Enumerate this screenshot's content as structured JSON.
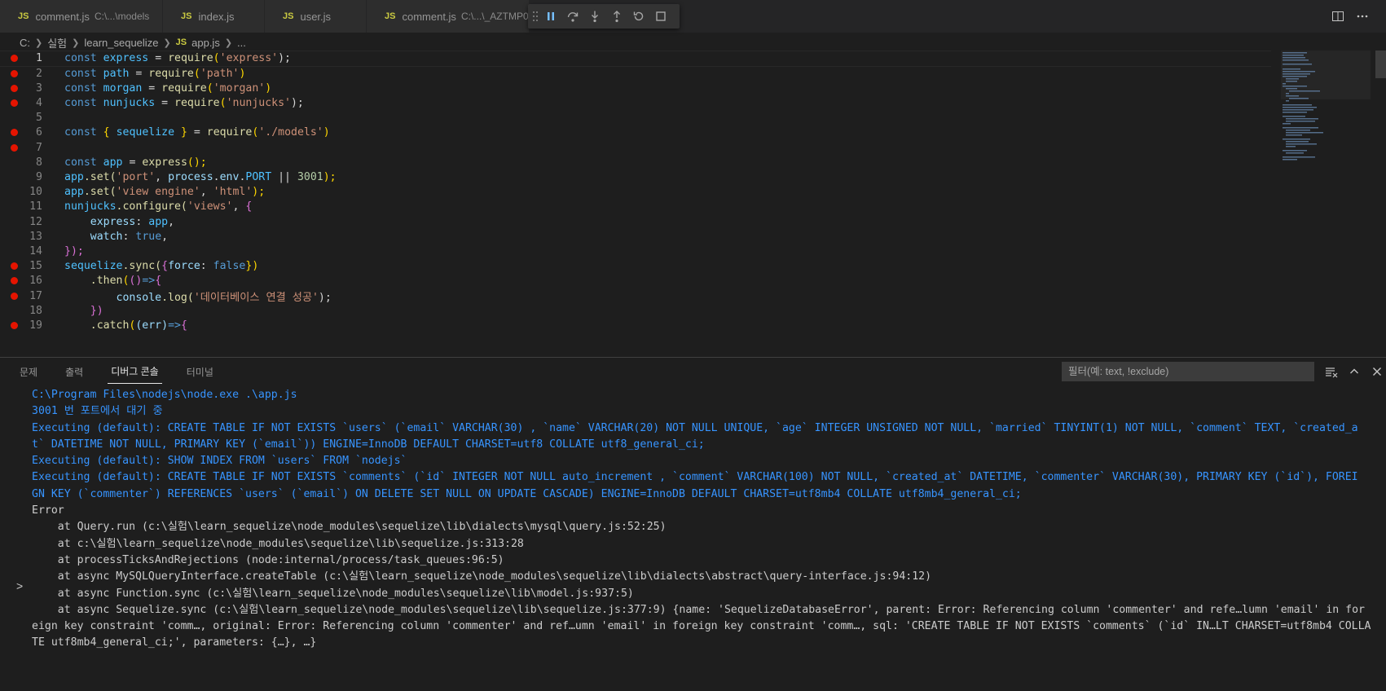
{
  "tabs": [
    {
      "icon": "JS",
      "name": "comment.js",
      "desc": "C:\\...\\models",
      "active": false
    },
    {
      "icon": "JS",
      "name": "index.js",
      "desc": "",
      "active": false
    },
    {
      "icon": "JS",
      "name": "user.js",
      "desc": "",
      "active": false
    },
    {
      "icon": "JS",
      "name": "comment.js",
      "desc": "C:\\...\\_AZTMP0",
      "active": false
    }
  ],
  "breadcrumb": {
    "drive": "C:",
    "folder1": "실험",
    "folder2": "learn_sequelize",
    "file_icon": "JS",
    "file": "app.js",
    "more": "..."
  },
  "editor": {
    "current_line": 1,
    "lines": [
      {
        "n": "1",
        "bp": true
      },
      {
        "n": "2",
        "bp": true
      },
      {
        "n": "3",
        "bp": true
      },
      {
        "n": "4",
        "bp": true
      },
      {
        "n": "5",
        "bp": false
      },
      {
        "n": "6",
        "bp": true
      },
      {
        "n": "7",
        "bp": true
      },
      {
        "n": "8",
        "bp": false
      },
      {
        "n": "9",
        "bp": false
      },
      {
        "n": "10",
        "bp": false
      },
      {
        "n": "11",
        "bp": false
      },
      {
        "n": "12",
        "bp": false
      },
      {
        "n": "13",
        "bp": false
      },
      {
        "n": "14",
        "bp": false
      },
      {
        "n": "15",
        "bp": true
      },
      {
        "n": "16",
        "bp": true
      },
      {
        "n": "17",
        "bp": true
      },
      {
        "n": "18",
        "bp": false
      },
      {
        "n": "19",
        "bp": true
      }
    ],
    "code": {
      "l1": [
        "const",
        "express",
        "=",
        "require",
        "(",
        "'express'",
        ");"
      ],
      "l2": [
        "const",
        "path",
        "=",
        "require",
        "(",
        "'path'",
        ")"
      ],
      "l3": [
        "const",
        "morgan",
        "=",
        "require",
        "(",
        "'morgan'",
        ")"
      ],
      "l4": [
        "const",
        "nunjucks",
        "=",
        "require",
        "(",
        "'nunjucks'",
        ");"
      ],
      "l6": [
        "const",
        "{",
        "sequelize",
        "}",
        "=",
        "require",
        "(",
        "'./models'",
        ")"
      ],
      "l8": [
        "const",
        "app",
        "=",
        "express",
        "();"
      ],
      "l9": [
        "app",
        ".set(",
        "'port'",
        ",",
        "process",
        ".",
        "env",
        ".",
        "PORT",
        "||",
        "3001",
        ");"
      ],
      "l10": [
        "app",
        ".set(",
        "'view engine'",
        ",",
        "'html'",
        ");"
      ],
      "l11": [
        "nunjucks",
        ".configure(",
        "'views'",
        ",",
        "{"
      ],
      "l12": [
        "express",
        ":",
        "app",
        ","
      ],
      "l13": [
        "watch",
        ":",
        "true",
        ","
      ],
      "l14": [
        "});"
      ],
      "l15": [
        "sequelize",
        ".sync(",
        "{",
        "force",
        ":",
        "false",
        "})"
      ],
      "l16": [
        ".then",
        "(",
        "()",
        "=>",
        "{"
      ],
      "l17": [
        "console",
        ".log(",
        "'데이터베이스 연결 성공'",
        ");"
      ],
      "l18": [
        "})"
      ],
      "l19": [
        ".catch",
        "(",
        "(err)",
        "=>",
        "{"
      ]
    }
  },
  "panel": {
    "tabs": [
      "문제",
      "출력",
      "디버그 콘솔",
      "터미널"
    ],
    "active_tab": "디버그 콘솔",
    "filter_placeholder": "필터(예: text, !exclude)",
    "console_lines": [
      {
        "text": "C:\\Program Files\\nodejs\\node.exe .\\app.js",
        "style": "blue"
      },
      {
        "text": "3001 번 포트에서 대기 중",
        "style": "blue"
      },
      {
        "text": "Executing (default): CREATE TABLE IF NOT EXISTS `users` (`email` VARCHAR(30) , `name` VARCHAR(20) NOT NULL UNIQUE, `age` INTEGER UNSIGNED NOT NULL, `married` TINYINT(1) NOT NULL, `comment` TEXT, `created_a",
        "style": "blue"
      },
      {
        "text": "t` DATETIME NOT NULL, PRIMARY KEY (`email`)) ENGINE=InnoDB DEFAULT CHARSET=utf8 COLLATE utf8_general_ci;",
        "style": "blue"
      },
      {
        "text": "Executing (default): SHOW INDEX FROM `users` FROM `nodejs`",
        "style": "blue"
      },
      {
        "text": "Executing (default): CREATE TABLE IF NOT EXISTS `comments` (`id` INTEGER NOT NULL auto_increment , `comment` VARCHAR(100) NOT NULL, `created_at` DATETIME, `commenter` VARCHAR(30), PRIMARY KEY (`id`), FOREI",
        "style": "blue"
      },
      {
        "text": "GN KEY (`commenter`) REFERENCES `users` (`email`) ON DELETE SET NULL ON UPDATE CASCADE) ENGINE=InnoDB DEFAULT CHARSET=utf8mb4 COLLATE utf8mb4_general_ci;",
        "style": "blue"
      },
      {
        "text": "Error",
        "style": "gray"
      },
      {
        "text": "    at Query.run (c:\\실험\\learn_sequelize\\node_modules\\sequelize\\lib\\dialects\\mysql\\query.js:52:25)",
        "style": "gray"
      },
      {
        "text": "    at c:\\실험\\learn_sequelize\\node_modules\\sequelize\\lib\\sequelize.js:313:28",
        "style": "gray"
      },
      {
        "text": "    at processTicksAndRejections (node:internal/process/task_queues:96:5)",
        "style": "gray"
      },
      {
        "text": "    at async MySQLQueryInterface.createTable (c:\\실험\\learn_sequelize\\node_modules\\sequelize\\lib\\dialects\\abstract\\query-interface.js:94:12)",
        "style": "gray"
      },
      {
        "text": "    at async Function.sync (c:\\실험\\learn_sequelize\\node_modules\\sequelize\\lib\\model.js:937:5)",
        "style": "gray"
      },
      {
        "text": "    at async Sequelize.sync (c:\\실험\\learn_sequelize\\node_modules\\sequelize\\lib\\sequelize.js:377:9) {name: 'SequelizeDatabaseError', parent: Error: Referencing column 'commenter' and refe…lumn 'email' in for",
        "style": "gray"
      },
      {
        "text": "eign key constraint 'comm…, original: Error: Referencing column 'commenter' and ref…umn 'email' in foreign key constraint 'comm…, sql: 'CREATE TABLE IF NOT EXISTS `comments` (`id` IN…LT CHARSET=utf8mb4 COLLA",
        "style": "gray"
      },
      {
        "text": "TE utf8mb4_general_ci;', parameters: {…}, …}",
        "style": "gray"
      }
    ],
    "expand_glyph": ">"
  },
  "colors": {
    "breakpoint": "#e51400",
    "console_blue": "#3794ff",
    "editor_bg": "#1e1e1e"
  }
}
